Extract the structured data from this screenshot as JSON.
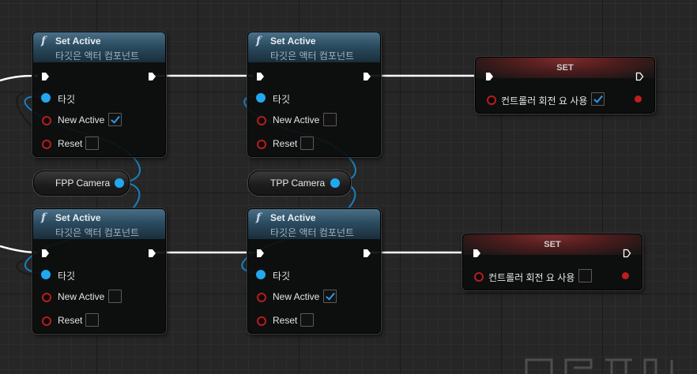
{
  "function_nodes": [
    {
      "title": "Set Active",
      "subtitle": "타깃은 액터 컴포넌트",
      "pins": {
        "target": "타깃",
        "new_active": "New Active",
        "reset": "Reset"
      },
      "new_active_checked": true,
      "reset_checked": false
    },
    {
      "title": "Set Active",
      "subtitle": "타깃은 액터 컴포넌트",
      "pins": {
        "target": "타깃",
        "new_active": "New Active",
        "reset": "Reset"
      },
      "new_active_checked": false,
      "reset_checked": false
    },
    {
      "title": "Set Active",
      "subtitle": "타깃은 액터 컴포넌트",
      "pins": {
        "target": "타깃",
        "new_active": "New Active",
        "reset": "Reset"
      },
      "new_active_checked": false,
      "reset_checked": false
    },
    {
      "title": "Set Active",
      "subtitle": "타깃은 액터 컴포넌트",
      "pins": {
        "target": "타깃",
        "new_active": "New Active",
        "reset": "Reset"
      },
      "new_active_checked": true,
      "reset_checked": false
    }
  ],
  "set_nodes": [
    {
      "title": "SET",
      "pin_label": "컨트롤러 회전 요 사용",
      "checked": true
    },
    {
      "title": "SET",
      "pin_label": "컨트롤러 회전 요 사용",
      "checked": false
    }
  ],
  "variables": [
    {
      "label": "FPP Camera"
    },
    {
      "label": "TPP Camera"
    }
  ],
  "colors": {
    "exec_wire": "#ffffff",
    "object_pin": "#22a8f0",
    "bool_pin": "#b31f1f",
    "function_header": "#2b4c60",
    "set_header": "#4a1c1c"
  },
  "icons": {
    "function": "function-f-icon",
    "exec": "exec-arrow-icon"
  }
}
